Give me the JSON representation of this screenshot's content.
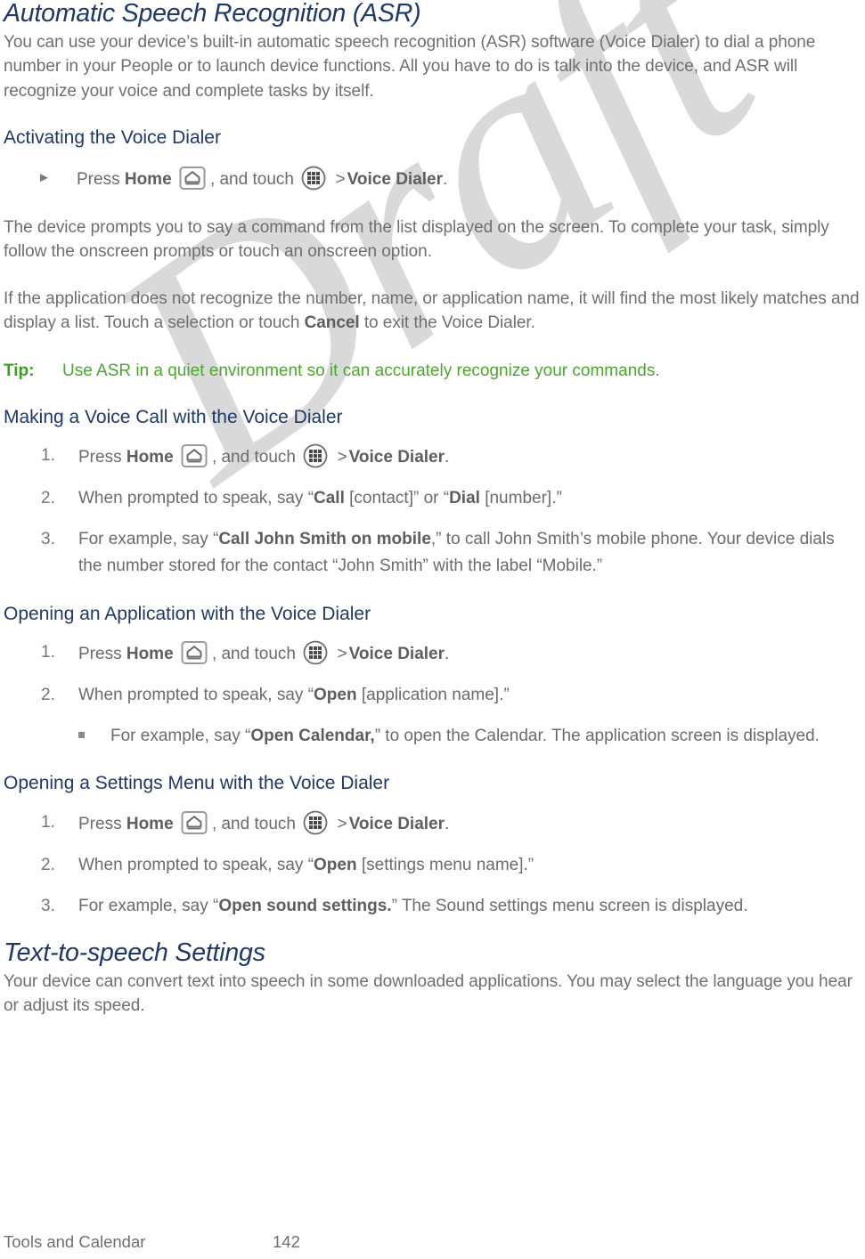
{
  "watermark": {
    "text": "Draft"
  },
  "sections": {
    "asr": {
      "title": "Automatic Speech Recognition (ASR)",
      "intro": "You can use your device’s built-in automatic speech recognition (ASR) software (Voice Dialer) to dial a phone number in your People or to launch device functions. All you have to do is talk into the device, and ASR will recognize your voice and complete tasks by itself.",
      "activating": {
        "heading": "Activating the Voice Dialer",
        "step": {
          "press": "Press",
          "home": "Home",
          "and_touch": ", and touch",
          "gt": ">",
          "voice_dialer": "Voice Dialer",
          "period": "."
        },
        "para1": "The device prompts you to say a command from the list displayed on the screen. To complete your task, simply follow the onscreen prompts or touch an onscreen option.",
        "para2_a": "If the application does not recognize the number, name, or application name, it will find the most likely matches and display a list. Touch a selection or touch ",
        "para2_b": "Cancel",
        "para2_c": " to exit the Voice Dialer."
      },
      "tip": {
        "label": "Tip:",
        "text": "Use ASR in a quiet environment so it can accurately recognize your commands."
      },
      "voice_call": {
        "heading": "Making a Voice Call with the Voice Dialer",
        "items": [
          {
            "num": "1."
          },
          {
            "num": "2.",
            "a": "When prompted to speak, say “",
            "b": "Call",
            "c": " [contact]” or “",
            "d": "Dial",
            "e": " [number].”"
          },
          {
            "num": "3.",
            "a": "For example, say “",
            "b": "Call John Smith on mobile",
            "c": ",” to call John Smith’s mobile phone. Your device dials the number stored for the contact “John Smith” with the label “Mobile.”"
          }
        ]
      },
      "open_app": {
        "heading": "Opening an Application with the Voice Dialer",
        "items": [
          {
            "num": "1."
          },
          {
            "num": "2.",
            "a": "When prompted to speak, say “",
            "b": "Open",
            "c": " [application name].”"
          }
        ],
        "sub": {
          "a": "For example, say “",
          "b": "Open Calendar,",
          "c": "” to open the Calendar. The application screen is displayed."
        }
      },
      "open_settings": {
        "heading": "Opening a Settings Menu with the Voice Dialer",
        "items": [
          {
            "num": "1."
          },
          {
            "num": "2.",
            "a": "When prompted to speak, say “",
            "b": "Open",
            "c": " [settings menu name].”"
          },
          {
            "num": "3.",
            "a": "For example, say “",
            "b": "Open sound settings.",
            "c": "” The Sound settings menu screen is displayed."
          }
        ]
      }
    },
    "tts": {
      "title": "Text-to-speech Settings",
      "intro": "Your device can convert text into speech in some downloaded applications. You may select the language you hear or adjust its speed."
    }
  },
  "footer": {
    "chapter": "Tools and Calendar",
    "page": "142"
  },
  "colors": {
    "heading": "#1F3864",
    "body": "#6f6f6f",
    "tip_label": "#3E9B2E",
    "tip_text": "#4CA62F",
    "watermark": "#d9d9d9"
  },
  "icons": {
    "home": "home-key-icon",
    "apps": "apps-grid-icon"
  }
}
